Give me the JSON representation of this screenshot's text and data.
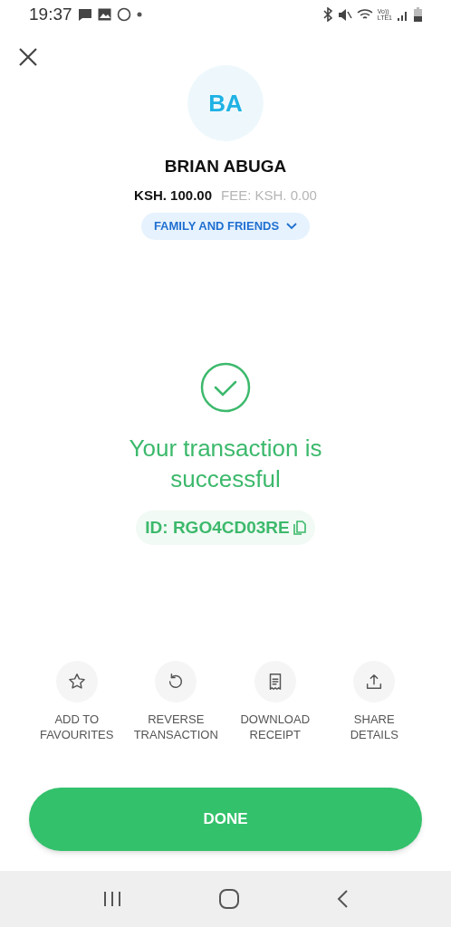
{
  "status_bar": {
    "time": "19:37",
    "volte": "Vo))",
    "network": "LTE1"
  },
  "recipient": {
    "initials": "BA",
    "name": "BRIAN ABUGA",
    "amount": "KSH. 100.00",
    "fee": "FEE: KSH. 0.00",
    "category": "FAMILY AND FRIENDS"
  },
  "result": {
    "message": "Your transaction is successful",
    "transaction_id": "ID: RGO4CD03RE"
  },
  "actions": [
    {
      "kind": "star",
      "label": "ADD TO\nFAVOURITES"
    },
    {
      "kind": "undo",
      "label": "REVERSE\nTRANSACTION"
    },
    {
      "kind": "receipt",
      "label": "DOWNLOAD\nRECEIPT"
    },
    {
      "kind": "share",
      "label": "SHARE\nDETAILS"
    }
  ],
  "done_button": "DONE"
}
